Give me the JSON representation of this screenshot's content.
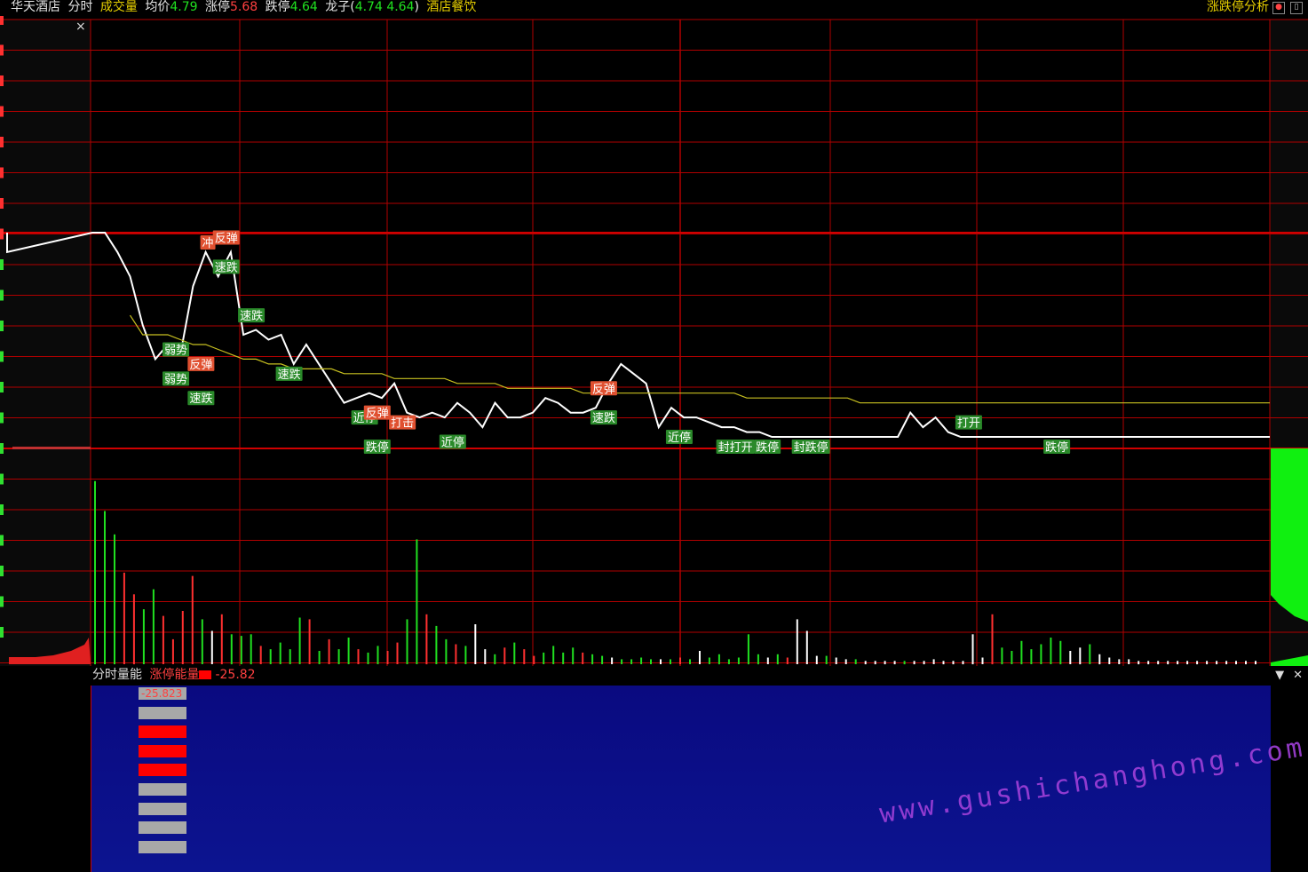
{
  "header": {
    "stock_name": "华天酒店",
    "tab_intraday": "分时",
    "tab_volume": "成交量",
    "avg_label": "均价",
    "avg_value": "4.79",
    "limit_up_label": "涨停",
    "limit_up_value": "5.68",
    "limit_down_label": "跌停",
    "limit_down_value": "4.64",
    "dragon_label": "龙子(",
    "dragon_values": "4.74 4.64",
    "dragon_close": ")",
    "sector": "酒店餐饮",
    "analysis_link": "涨跌停分析"
  },
  "lower_panel": {
    "title": "分时量能",
    "indicator_name": "涨停能量",
    "indicator_value": "-25.82",
    "bar_value_label": "-25.823",
    "bars": [
      "gray",
      "gray",
      "red",
      "red",
      "red",
      "gray",
      "gray",
      "gray",
      "gray"
    ]
  },
  "colors": {
    "up": "#ff3030",
    "down": "#20e020",
    "price_line": "#ffffff",
    "avg_line": "#c8c020",
    "grid": "#b00000"
  },
  "chart_data": {
    "type": "line",
    "title": "",
    "series": [
      {
        "values": [
          5.21,
          5.21,
          5.17,
          5.12,
          5.02,
          4.95,
          4.98,
          4.96,
          5.1,
          5.17,
          5.12,
          5.17,
          5.0,
          5.01,
          4.99,
          5.0,
          4.94,
          4.98,
          4.94,
          4.9,
          4.86,
          4.87,
          4.88,
          4.87,
          4.9,
          4.84,
          4.83,
          4.84,
          4.83,
          4.86,
          4.84,
          4.81,
          4.86,
          4.83,
          4.83,
          4.84,
          4.87,
          4.86,
          4.84,
          4.84,
          4.85,
          4.9,
          4.94,
          4.92,
          4.9,
          4.81,
          4.85,
          4.83,
          4.83,
          4.82,
          4.81,
          4.81,
          4.8,
          4.8,
          4.79,
          4.79,
          4.79,
          4.79,
          4.79,
          4.79,
          4.79,
          4.79,
          4.79,
          4.79,
          4.79,
          4.84,
          4.81,
          4.83,
          4.8,
          4.79,
          4.79,
          4.79,
          4.79,
          4.79,
          4.79,
          4.79,
          4.79,
          4.79,
          4.79,
          4.79,
          4.79,
          4.79
        ]
      },
      {
        "values": [
          5.21,
          5.18,
          5.14,
          5.04,
          5.0,
          5.0,
          5.0,
          4.99,
          4.98,
          4.98,
          4.97,
          4.96,
          4.95,
          4.95,
          4.94,
          4.94,
          4.93,
          4.93,
          4.93,
          4.93,
          4.92,
          4.92,
          4.92,
          4.92,
          4.91,
          4.91,
          4.91,
          4.91,
          4.91,
          4.9,
          4.9,
          4.9,
          4.9,
          4.89,
          4.89,
          4.89,
          4.89,
          4.89,
          4.89,
          4.88,
          4.88,
          4.88,
          4.88,
          4.88,
          4.88,
          4.88,
          4.88,
          4.88,
          4.88,
          4.88,
          4.88,
          4.88,
          4.87,
          4.87,
          4.87,
          4.87,
          4.87,
          4.87,
          4.87,
          4.87,
          4.87,
          4.86,
          4.86,
          4.86,
          4.86,
          4.86,
          4.86,
          4.86,
          4.86,
          4.86,
          4.86,
          4.86,
          4.86,
          4.86,
          4.86,
          4.86,
          4.86,
          4.86,
          4.86,
          4.86,
          4.86,
          4.86
        ]
      }
    ],
    "annotations": [
      {
        "text": "冲",
        "i": 9,
        "v": 5.19,
        "kind": "up"
      },
      {
        "text": "反弹",
        "i": 10,
        "v": 5.2,
        "kind": "up"
      },
      {
        "text": "速跌",
        "i": 10,
        "v": 5.14,
        "kind": "down"
      },
      {
        "text": "弱势",
        "i": 6,
        "v": 4.97,
        "kind": "down"
      },
      {
        "text": "弱势",
        "i": 6,
        "v": 4.91,
        "kind": "down"
      },
      {
        "text": "反弹",
        "i": 8,
        "v": 4.94,
        "kind": "up"
      },
      {
        "text": "速跌",
        "i": 8,
        "v": 4.87,
        "kind": "down"
      },
      {
        "text": "速跌",
        "i": 12,
        "v": 5.04,
        "kind": "down"
      },
      {
        "text": "速跌",
        "i": 15,
        "v": 4.92,
        "kind": "down"
      },
      {
        "text": "近停",
        "i": 21,
        "v": 4.83,
        "kind": "down"
      },
      {
        "text": "反弹",
        "i": 22,
        "v": 4.84,
        "kind": "up"
      },
      {
        "text": "跌停",
        "i": 22,
        "v": 4.77,
        "kind": "down"
      },
      {
        "text": "打击",
        "i": 24,
        "v": 4.82,
        "kind": "up"
      },
      {
        "text": "近停",
        "i": 28,
        "v": 4.78,
        "kind": "down"
      },
      {
        "text": "反弹",
        "i": 40,
        "v": 4.89,
        "kind": "up"
      },
      {
        "text": "速跌",
        "i": 40,
        "v": 4.83,
        "kind": "down"
      },
      {
        "text": "近停",
        "i": 46,
        "v": 4.79,
        "kind": "down"
      },
      {
        "text": "封打开",
        "i": 50,
        "v": 4.77,
        "kind": "down"
      },
      {
        "text": "跌停",
        "i": 53,
        "v": 4.77,
        "kind": "down"
      },
      {
        "text": "封跌停",
        "i": 56,
        "v": 4.77,
        "kind": "down"
      },
      {
        "text": "打开",
        "i": 69,
        "v": 4.82,
        "kind": "down"
      },
      {
        "text": "跌停",
        "i": 76,
        "v": 4.77,
        "kind": "down"
      }
    ],
    "volume": [
      {
        "v": 110,
        "c": "g"
      },
      {
        "v": 92,
        "c": "g"
      },
      {
        "v": 78,
        "c": "g"
      },
      {
        "v": 55,
        "c": "r"
      },
      {
        "v": 42,
        "c": "r"
      },
      {
        "v": 33,
        "c": "g"
      },
      {
        "v": 45,
        "c": "g"
      },
      {
        "v": 29,
        "c": "r"
      },
      {
        "v": 15,
        "c": "r"
      },
      {
        "v": 32,
        "c": "r"
      },
      {
        "v": 53,
        "c": "r"
      },
      {
        "v": 27,
        "c": "g"
      },
      {
        "v": 20,
        "c": "w"
      },
      {
        "v": 30,
        "c": "r"
      },
      {
        "v": 18,
        "c": "g"
      },
      {
        "v": 17,
        "c": "g"
      },
      {
        "v": 18,
        "c": "g"
      },
      {
        "v": 11,
        "c": "r"
      },
      {
        "v": 9,
        "c": "g"
      },
      {
        "v": 13,
        "c": "g"
      },
      {
        "v": 9,
        "c": "g"
      },
      {
        "v": 28,
        "c": "g"
      },
      {
        "v": 27,
        "c": "r"
      },
      {
        "v": 8,
        "c": "g"
      },
      {
        "v": 15,
        "c": "r"
      },
      {
        "v": 9,
        "c": "g"
      },
      {
        "v": 16,
        "c": "g"
      },
      {
        "v": 9,
        "c": "r"
      },
      {
        "v": 7,
        "c": "g"
      },
      {
        "v": 11,
        "c": "g"
      },
      {
        "v": 8,
        "c": "r"
      },
      {
        "v": 13,
        "c": "r"
      },
      {
        "v": 27,
        "c": "g"
      },
      {
        "v": 75,
        "c": "g"
      },
      {
        "v": 30,
        "c": "r"
      },
      {
        "v": 23,
        "c": "g"
      },
      {
        "v": 15,
        "c": "g"
      },
      {
        "v": 12,
        "c": "r"
      },
      {
        "v": 11,
        "c": "g"
      },
      {
        "v": 24,
        "c": "w"
      },
      {
        "v": 9,
        "c": "w"
      },
      {
        "v": 6,
        "c": "g"
      },
      {
        "v": 10,
        "c": "r"
      },
      {
        "v": 13,
        "c": "g"
      },
      {
        "v": 9,
        "c": "r"
      },
      {
        "v": 5,
        "c": "r"
      },
      {
        "v": 7,
        "c": "g"
      },
      {
        "v": 11,
        "c": "g"
      },
      {
        "v": 7,
        "c": "g"
      },
      {
        "v": 10,
        "c": "g"
      },
      {
        "v": 7,
        "c": "r"
      },
      {
        "v": 6,
        "c": "g"
      },
      {
        "v": 5,
        "c": "g"
      },
      {
        "v": 4,
        "c": "w"
      },
      {
        "v": 3,
        "c": "g"
      },
      {
        "v": 3,
        "c": "g"
      },
      {
        "v": 4,
        "c": "g"
      },
      {
        "v": 3,
        "c": "g"
      },
      {
        "v": 3,
        "c": "w"
      },
      {
        "v": 3,
        "c": "g"
      },
      {
        "v": 4,
        "c": "r"
      },
      {
        "v": 3,
        "c": "g"
      },
      {
        "v": 8,
        "c": "w"
      },
      {
        "v": 4,
        "c": "g"
      },
      {
        "v": 6,
        "c": "g"
      },
      {
        "v": 3,
        "c": "g"
      },
      {
        "v": 4,
        "c": "g"
      },
      {
        "v": 18,
        "c": "g"
      },
      {
        "v": 6,
        "c": "g"
      },
      {
        "v": 4,
        "c": "w"
      },
      {
        "v": 6,
        "c": "g"
      },
      {
        "v": 4,
        "c": "r"
      },
      {
        "v": 27,
        "c": "w"
      },
      {
        "v": 20,
        "c": "w"
      },
      {
        "v": 5,
        "c": "w"
      },
      {
        "v": 5,
        "c": "g"
      },
      {
        "v": 4,
        "c": "w"
      },
      {
        "v": 3,
        "c": "w"
      },
      {
        "v": 3,
        "c": "g"
      },
      {
        "v": 2,
        "c": "w"
      },
      {
        "v": 2,
        "c": "w"
      },
      {
        "v": 2,
        "c": "w"
      },
      {
        "v": 2,
        "c": "w"
      },
      {
        "v": 2,
        "c": "g"
      },
      {
        "v": 2,
        "c": "w"
      },
      {
        "v": 2,
        "c": "w"
      },
      {
        "v": 3,
        "c": "w"
      },
      {
        "v": 2,
        "c": "w"
      },
      {
        "v": 2,
        "c": "w"
      },
      {
        "v": 2,
        "c": "w"
      },
      {
        "v": 18,
        "c": "w"
      },
      {
        "v": 4,
        "c": "w"
      },
      {
        "v": 30,
        "c": "r"
      },
      {
        "v": 10,
        "c": "g"
      },
      {
        "v": 8,
        "c": "g"
      },
      {
        "v": 14,
        "c": "g"
      },
      {
        "v": 9,
        "c": "g"
      },
      {
        "v": 12,
        "c": "g"
      },
      {
        "v": 16,
        "c": "g"
      },
      {
        "v": 14,
        "c": "g"
      },
      {
        "v": 8,
        "c": "w"
      },
      {
        "v": 10,
        "c": "w"
      },
      {
        "v": 12,
        "c": "g"
      },
      {
        "v": 6,
        "c": "w"
      },
      {
        "v": 4,
        "c": "w"
      },
      {
        "v": 3,
        "c": "w"
      },
      {
        "v": 3,
        "c": "w"
      },
      {
        "v": 2,
        "c": "w"
      },
      {
        "v": 2,
        "c": "w"
      },
      {
        "v": 2,
        "c": "w"
      },
      {
        "v": 2,
        "c": "w"
      },
      {
        "v": 2,
        "c": "w"
      },
      {
        "v": 2,
        "c": "w"
      },
      {
        "v": 2,
        "c": "w"
      },
      {
        "v": 2,
        "c": "w"
      },
      {
        "v": 2,
        "c": "w"
      },
      {
        "v": 2,
        "c": "w"
      },
      {
        "v": 2,
        "c": "w"
      },
      {
        "v": 2,
        "c": "w"
      },
      {
        "v": 2,
        "c": "w"
      }
    ],
    "ylim": [
      4.64,
      5.68
    ]
  }
}
